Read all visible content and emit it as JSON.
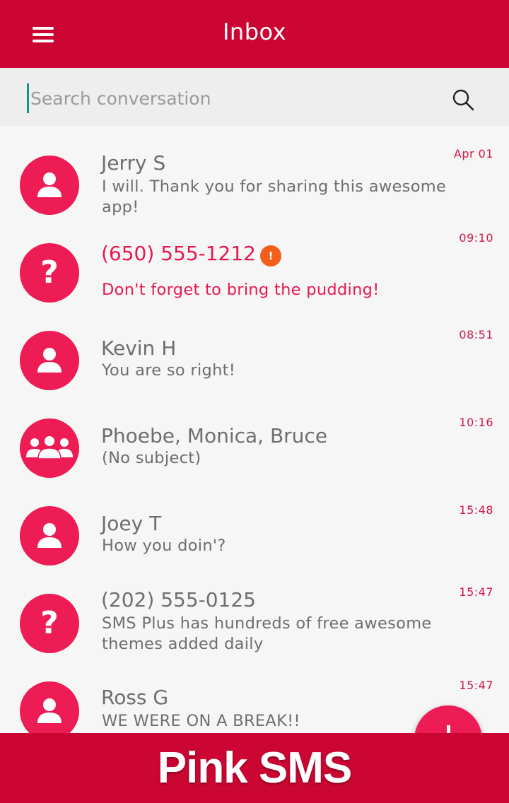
{
  "header": {
    "title": "Inbox",
    "menu_icon": "hamburger-menu-icon"
  },
  "search": {
    "placeholder": "Search conversation",
    "value": "",
    "icon": "search-icon"
  },
  "conversations": [
    {
      "name": "Jerry S",
      "message": " I will. Thank you for sharing this awesome app!",
      "time": "Apr 01",
      "avatar": "person-icon",
      "unread": false
    },
    {
      "name": "(650) 555-1212",
      "message": "Don't forget to bring the pudding!",
      "time": "09:10",
      "avatar": "question-mark-icon",
      "unread": true,
      "badge": "!"
    },
    {
      "name": "Kevin H",
      "message": "You are so right!",
      "time": "08:51",
      "avatar": "person-icon",
      "unread": false
    },
    {
      "name": "Phoebe, Monica, Bruce",
      "message": "(No subject)",
      "time": "10:16",
      "avatar": "group-icon",
      "unread": false
    },
    {
      "name": "Joey T",
      "message": " How you doin'?",
      "time": "15:48",
      "avatar": "person-icon",
      "unread": false
    },
    {
      "name": "(202) 555-0125",
      "message": " SMS Plus has hundreds of free awesome themes added daily",
      "time": "15:47",
      "avatar": "question-mark-icon",
      "unread": false
    },
    {
      "name": "Ross G",
      "message": " WE WERE ON A BREAK!!",
      "time": "15:47",
      "avatar": "person-icon",
      "unread": false
    }
  ],
  "fab": {
    "icon": "plus-icon"
  },
  "footer": {
    "brand": "Pink SMS"
  },
  "colors": {
    "primary": "#cc0633",
    "accent": "#ee1c55",
    "badge": "#f35f1a"
  }
}
